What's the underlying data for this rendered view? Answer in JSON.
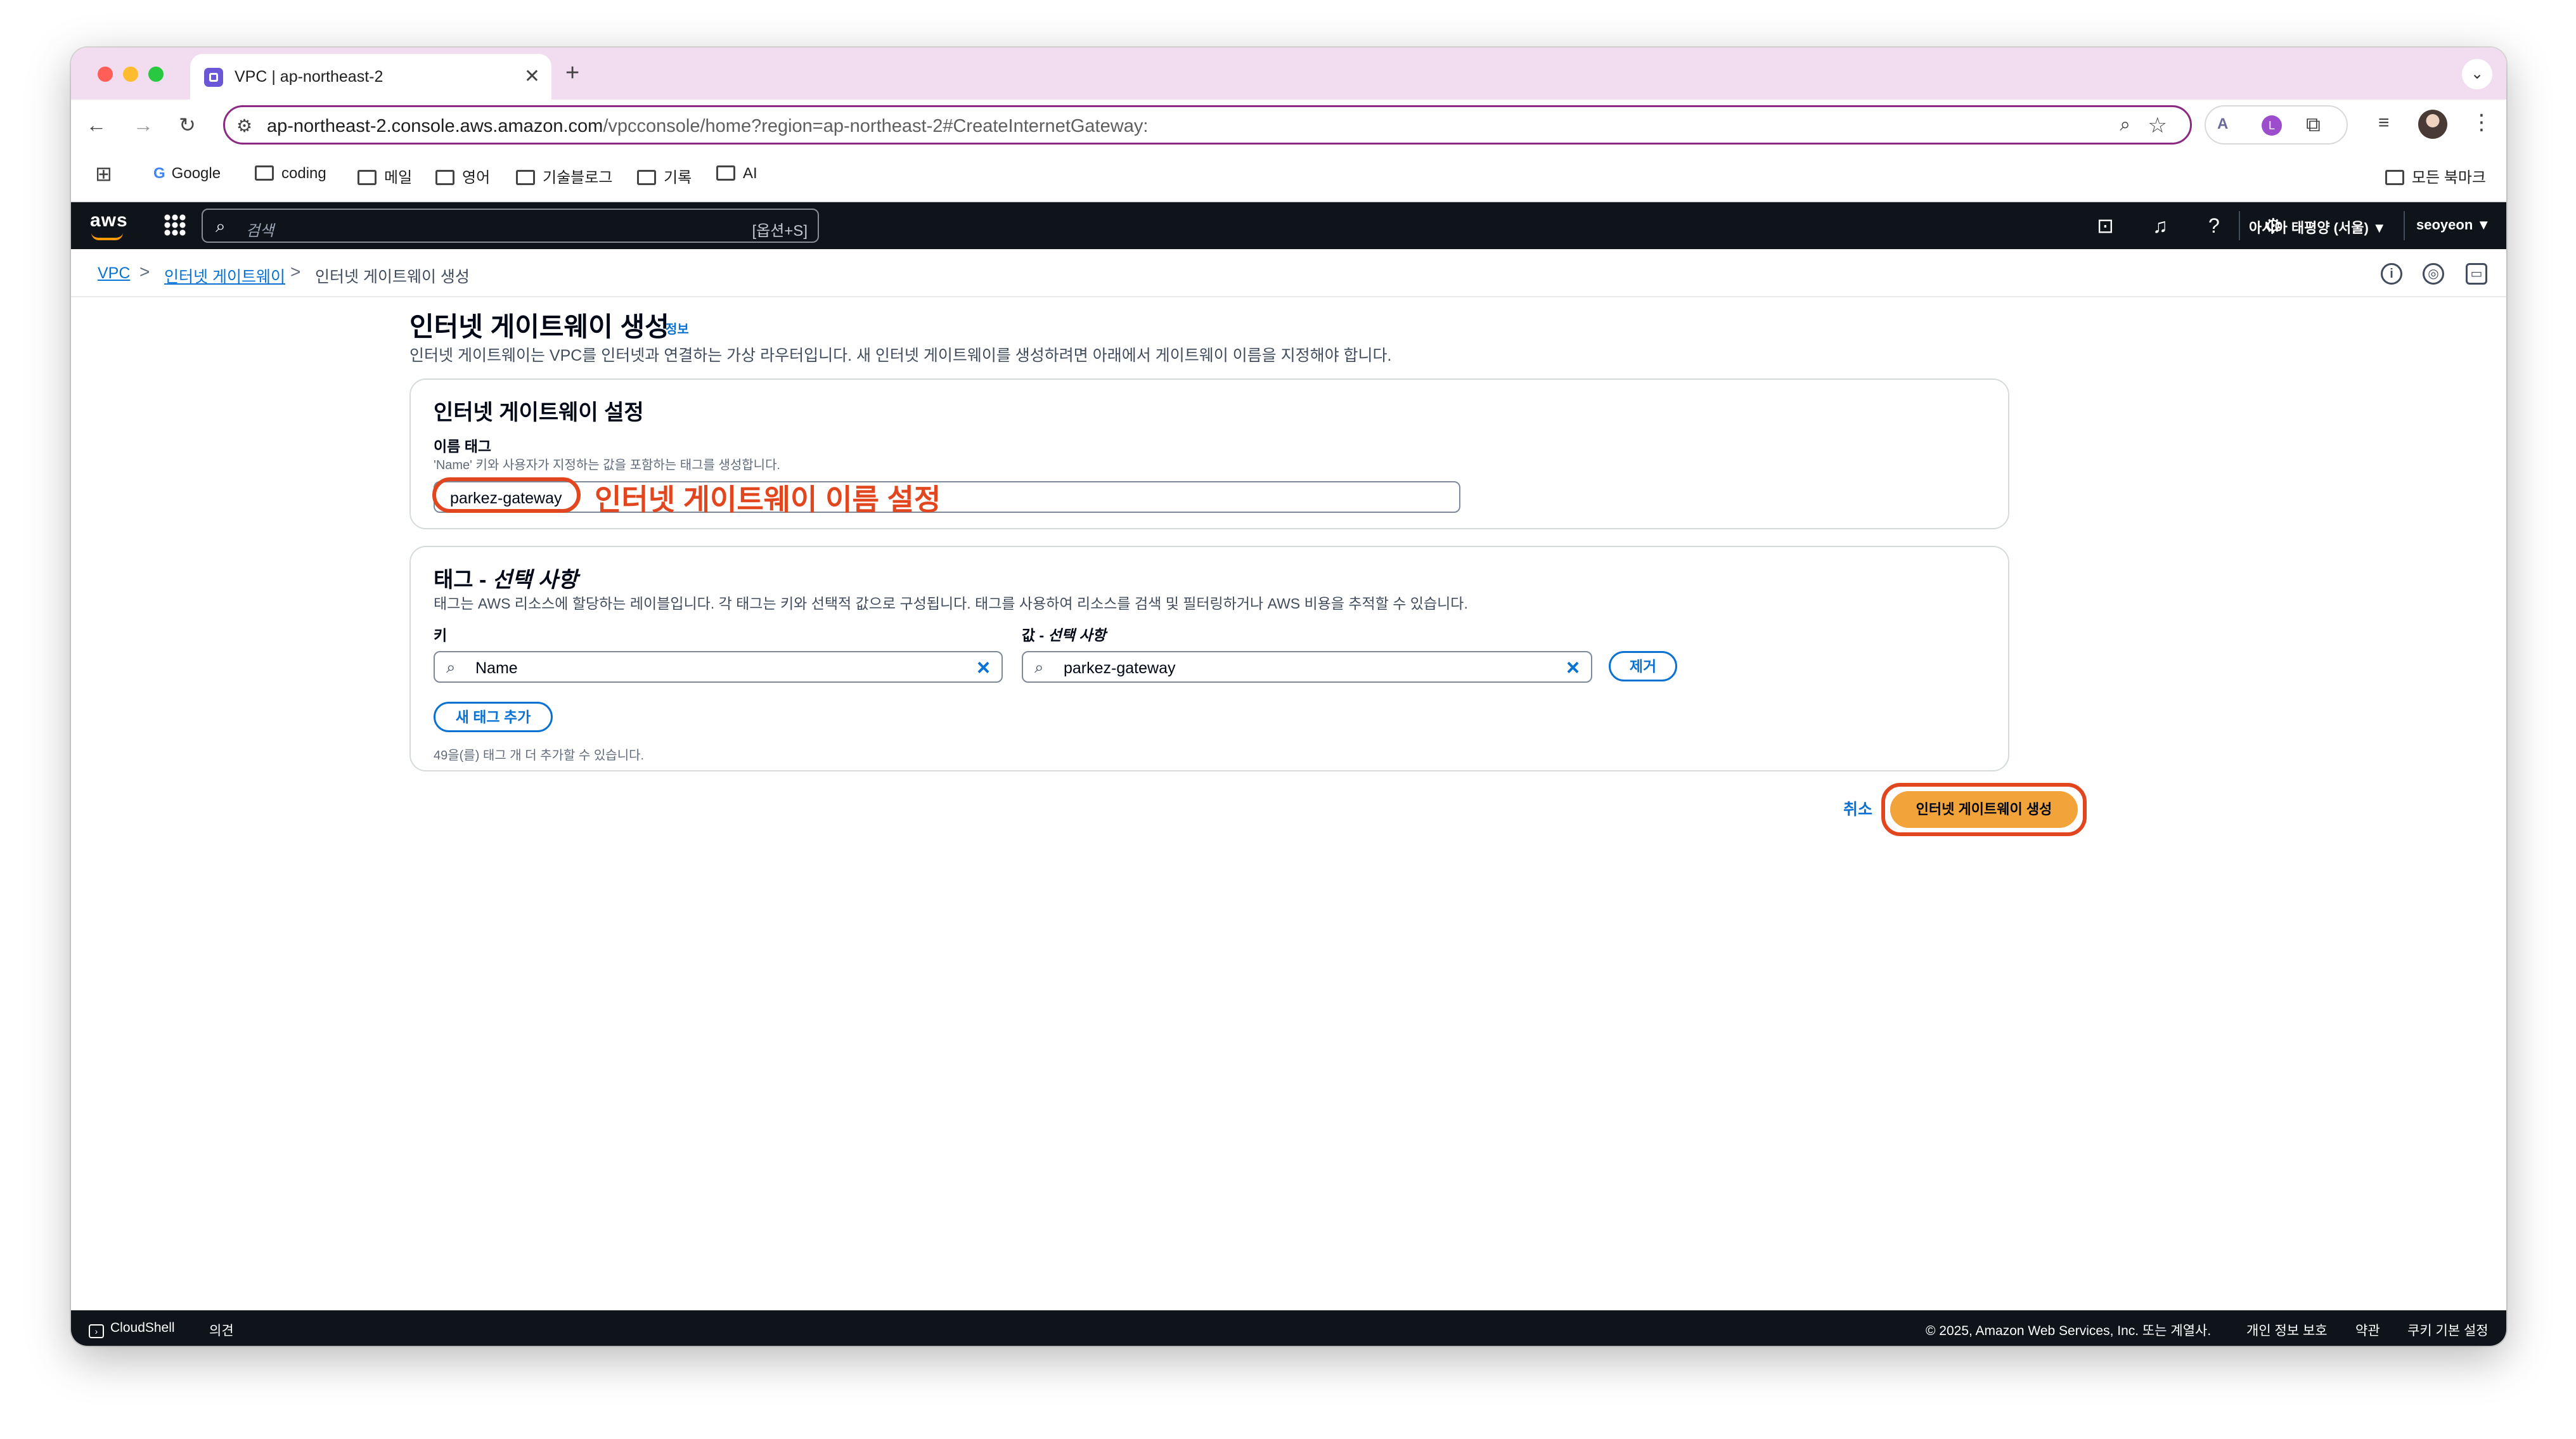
{
  "browser": {
    "tab_title": "VPC | ap-northeast-2",
    "tab_close": "✕",
    "new_tab": "+",
    "url_host": "ap-northeast-2.console.aws.amazon.com",
    "url_path": "/vpcconsole/home?region=ap-northeast-2#CreateInternetGateway:",
    "bookmarks": [
      "Google",
      "coding",
      "메일",
      "영어",
      "기술블로그",
      "기록",
      "AI"
    ],
    "bookmarks_all": "모든 북마크"
  },
  "aws_nav": {
    "logo": "aws",
    "search_placeholder": "검색",
    "search_shortcut": "[옵션+S]",
    "region": "아시아 태평양 (서울) ▼",
    "user": "seoyeon ▼"
  },
  "breadcrumb": {
    "items": [
      "VPC",
      "인터넷 게이트웨이"
    ],
    "current": "인터넷 게이트웨이 생성",
    "separator": ">"
  },
  "page": {
    "title": "인터넷 게이트웨이 생성",
    "info": "정보",
    "description": "인터넷 게이트웨이는 VPC를 인터넷과 연결하는 가상 라우터입니다. 새 인터넷 게이트웨이를 생성하려면 아래에서 게이트웨이 이름을 지정해야 합니다."
  },
  "settings_panel": {
    "title": "인터넷 게이트웨이 설정",
    "name_tag_label": "이름 태그",
    "name_tag_desc": "'Name' 키와 사용자가 지정하는 값을 포함하는 태그를 생성합니다.",
    "name_value": "parkez-gateway"
  },
  "annotation": {
    "text": "인터넷 게이트웨이 이름 설정",
    "color": "#e2461f"
  },
  "tags_panel": {
    "title_prefix": "태그 - ",
    "title_optional": "선택 사항",
    "description": "태그는 AWS 리소스에 할당하는 레이블입니다. 각 태그는 키와 선택적 값으로 구성됩니다. 태그를 사용하여 리소스를 검색 및 필터링하거나 AWS 비용을 추적할 수 있습니다.",
    "key_label": "키",
    "value_label_prefix": "값 - ",
    "value_label_optional": "선택 사항",
    "key": "Name",
    "value": "parkez-gateway",
    "remove": "제거",
    "add_tag": "새 태그 추가",
    "hint": "49을(를) 태그 개 더 추가할 수 있습니다."
  },
  "actions": {
    "cancel": "취소",
    "create": "인터넷 게이트웨이 생성",
    "create_color": "#f2a33a"
  },
  "footer": {
    "cloudshell": "CloudShell",
    "feedback": "의견",
    "copyright": "© 2025, Amazon Web Services, Inc. 또는 계열사.",
    "privacy": "개인 정보 보호",
    "terms": "약관",
    "cookies": "쿠키 기본 설정"
  },
  "icons": [
    "search-icon",
    "close-icon",
    "bell-icon",
    "help-icon",
    "gear-icon",
    "cloudshell-icon",
    "info-icon",
    "star-icon",
    "reload-icon"
  ]
}
